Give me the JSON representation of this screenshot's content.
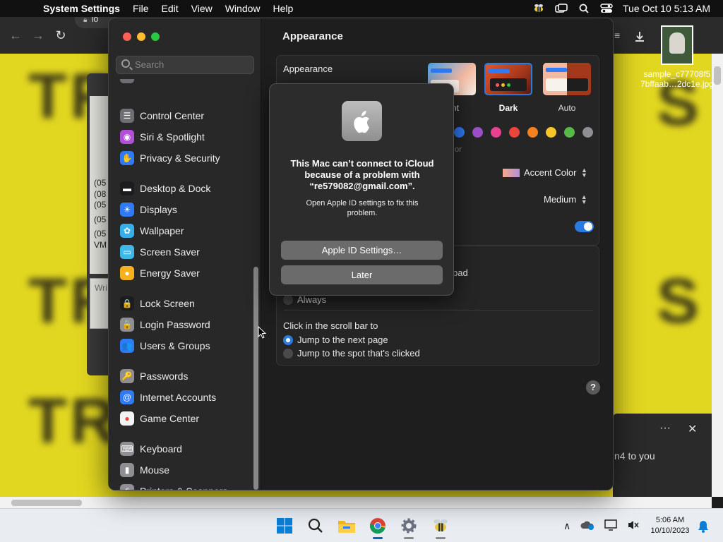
{
  "menubar": {
    "app_name": "System Settings",
    "menus": [
      "File",
      "Edit",
      "View",
      "Window",
      "Help"
    ],
    "clock": "Tue Oct 10  5:13 AM"
  },
  "browser": {
    "url_fragment": "lo"
  },
  "background_chat": {
    "lines": [
      "(05",
      "(08",
      "(05",
      "(05",
      "(05",
      "VM"
    ],
    "input_placeholder": "Wri"
  },
  "desktop_file": {
    "name_line1": "sample_c77708f5",
    "name_line2": "7bffaab…2dc1e.jpg"
  },
  "toast": {
    "more": "···",
    "close": "✕",
    "message": "n4 to you"
  },
  "sidebar": {
    "search_placeholder": "Search",
    "items": [
      {
        "label": "Control Center",
        "color": "#6e6e73",
        "glyph": "☰"
      },
      {
        "label": "Siri & Spotlight",
        "color": "#b14fd6",
        "glyph": "◉"
      },
      {
        "label": "Privacy & Security",
        "color": "#2f7bf5",
        "glyph": "✋"
      },
      {
        "label": "Desktop & Dock",
        "color": "#1c1c1e",
        "glyph": "▬"
      },
      {
        "label": "Displays",
        "color": "#2f7bf5",
        "glyph": "☀"
      },
      {
        "label": "Wallpaper",
        "color": "#36aeea",
        "glyph": "✿"
      },
      {
        "label": "Screen Saver",
        "color": "#3fb8e8",
        "glyph": "▭"
      },
      {
        "label": "Energy Saver",
        "color": "#f6b21c",
        "glyph": "●"
      },
      {
        "label": "Lock Screen",
        "color": "#1c1c1e",
        "glyph": "🔒"
      },
      {
        "label": "Login Password",
        "color": "#8e8e93",
        "glyph": "🔒"
      },
      {
        "label": "Users & Groups",
        "color": "#2f7bf5",
        "glyph": "👥"
      },
      {
        "label": "Passwords",
        "color": "#8e8e93",
        "glyph": "🔑"
      },
      {
        "label": "Internet Accounts",
        "color": "#2f7bf5",
        "glyph": "@"
      },
      {
        "label": "Game Center",
        "color": "#f2f2f2",
        "glyph": "●"
      },
      {
        "label": "Keyboard",
        "color": "#8e8e93",
        "glyph": "⌨"
      },
      {
        "label": "Mouse",
        "color": "#8e8e93",
        "glyph": "▮"
      },
      {
        "label": "Printers & Scanners",
        "color": "#8e8e93",
        "glyph": "⎙"
      }
    ]
  },
  "content": {
    "title": "Appearance",
    "appearance_label": "Appearance",
    "themes": [
      {
        "label": "nt",
        "selected": false
      },
      {
        "label": "Dark",
        "selected": true
      },
      {
        "label": "Auto",
        "selected": false
      }
    ],
    "accent_colors": [
      "#2f7bf5",
      "#9b4fc7",
      "#e7418f",
      "#e9453d",
      "#f5821f",
      "#f6c526",
      "#57b947",
      "#8e8e93"
    ],
    "accent_caption_fragment": "or",
    "highlight_color": "Accent Color",
    "sidebar_icon_size": "Medium",
    "scrollbar_fragment": "ckpad",
    "always_label": "Always",
    "scroll_click_label": "Click in the scroll bar to",
    "scroll_options": [
      {
        "label": "Jump to the next page",
        "selected": true
      },
      {
        "label": "Jump to the spot that's clicked",
        "selected": false
      }
    ],
    "help": "?"
  },
  "alert": {
    "title": "This Mac can’t connect to iCloud because of a problem with “re579082@gmail.com”.",
    "message": "Open Apple ID settings to fix this problem.",
    "primary_button": "Apple ID Settings…",
    "secondary_button": "Later"
  },
  "taskbar": {
    "time": "5:06 AM",
    "date": "10/10/2023"
  }
}
